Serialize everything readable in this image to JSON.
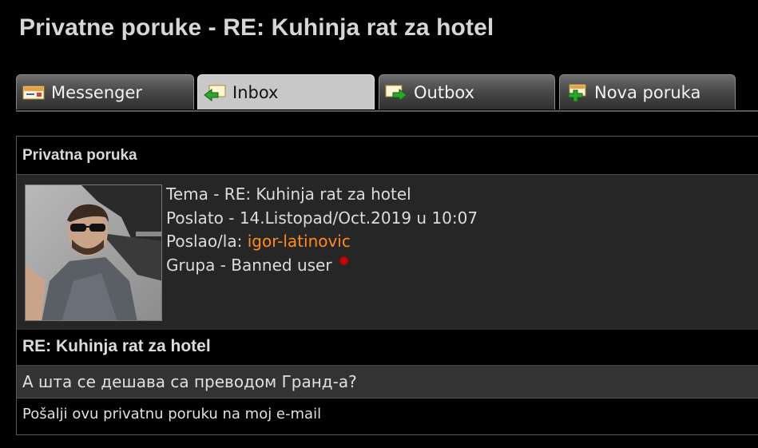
{
  "page": {
    "title": "Privatne poruke - RE: Kuhinja rat za hotel"
  },
  "tabs": [
    {
      "label": "Messenger",
      "icon": "envelope-icon",
      "active": false
    },
    {
      "label": "Inbox",
      "icon": "inbox-arrow-icon",
      "active": true
    },
    {
      "label": "Outbox",
      "icon": "outbox-arrow-icon",
      "active": false
    },
    {
      "label": "Nova poruka",
      "icon": "new-message-plus-icon",
      "active": false
    }
  ],
  "panel": {
    "header": "Privatna poruka"
  },
  "message": {
    "topic": "Tema - RE: Kuhinja rat za hotel",
    "sent": "Poslato - 14.Listopad/Oct.2019 u 10:07",
    "sender_label": "Poslao/la:",
    "sender_name": "igor-latinovic",
    "group": "Grupa - Banned user",
    "subject": "RE: Kuhinja rat za hotel",
    "body": "А шта се дешава са преводом Гранд-а?",
    "email_link": "Pošalji ovu privatnu poruku na moj e-mail"
  },
  "colors": {
    "background": "#000000",
    "sender_link": "#ff8c1a",
    "banned_indicator": "#cc0000",
    "active_tab": "#c8c8c8"
  }
}
